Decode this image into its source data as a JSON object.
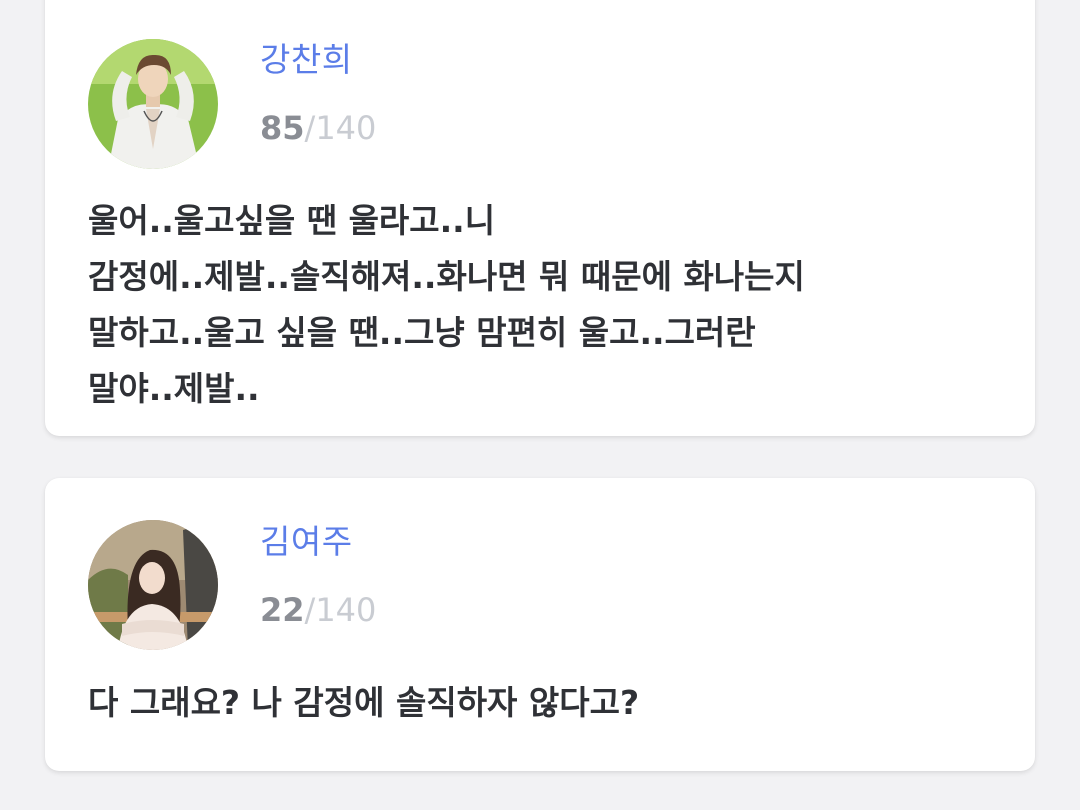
{
  "colors": {
    "background": "#f2f2f4",
    "card": "#ffffff",
    "name": "#5b7de8",
    "count_current": "#8a8d94",
    "count_max": "#c9ccd2",
    "message_text": "#2f3136"
  },
  "posts": [
    {
      "author": "강찬희",
      "count_current": "85",
      "count_max": "/140",
      "message_lines": [
        "울어..울고싶을 땐 울라고..니",
        "감정에..제발..솔직해져..화나면 뭐 때문에 화나는지",
        "말하고..울고 싶을 땐..그냥 맘편히 울고..그러란",
        "말야..제발.."
      ]
    },
    {
      "author": "김여주",
      "count_current": "22",
      "count_max": "/140",
      "message_lines": [
        "다 그래요? 나 감정에 솔직하자 않다고?"
      ]
    }
  ]
}
